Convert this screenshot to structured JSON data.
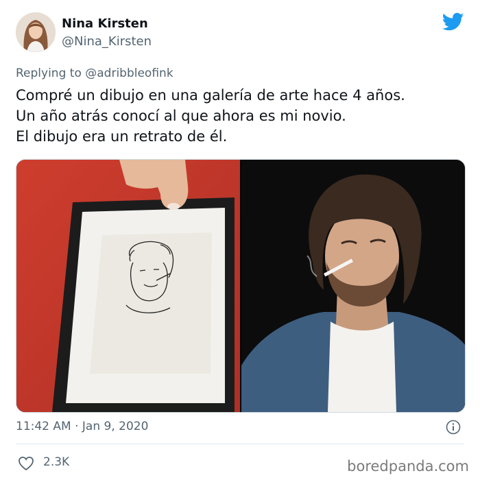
{
  "author": {
    "name": "Nina Kirsten",
    "handle": "@Nina_Kirsten"
  },
  "reply": {
    "prefix": "Replying to",
    "handle": "@adribbleofink"
  },
  "tweet": {
    "lines": [
      "Compré un dibujo en una galería de arte hace 4 años.",
      "Un año atrás conocí al que ahora es mi novio.",
      "El dibujo era un retrato de él."
    ]
  },
  "meta": {
    "timestamp": "11:42 AM · Jan 9, 2020"
  },
  "engagement": {
    "likes": "2.3K"
  },
  "watermark": "boredpanda.com",
  "icons": {
    "platform": "twitter-bird-icon",
    "info": "info-icon",
    "like": "heart-icon"
  },
  "colors": {
    "brand": "#1d9bf0",
    "text": "#0f1419",
    "secondary": "#536471",
    "red_wall": "#c8372c"
  }
}
